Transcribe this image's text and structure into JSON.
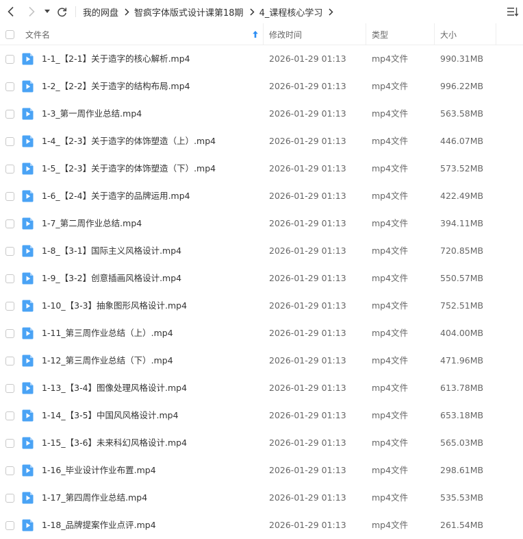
{
  "breadcrumb": [
    "我的网盘",
    "智疯字体版式设计课第18期",
    "4_课程核心学习"
  ],
  "columns": {
    "name": "文件名",
    "modified": "修改时间",
    "type": "类型",
    "size": "大小"
  },
  "sort": {
    "column": "name",
    "direction": "ascending"
  },
  "colors": {
    "accent": "#2b8df3",
    "file_icon": "#4aa3f5"
  },
  "files": [
    {
      "name": "1-1_【2-1】关于造字的核心解析.mp4",
      "modified": "2026-01-29 01:13",
      "type": "mp4文件",
      "size": "990.31MB"
    },
    {
      "name": "1-2_【2-2】关于造字的结构布局.mp4",
      "modified": "2026-01-29 01:13",
      "type": "mp4文件",
      "size": "996.22MB"
    },
    {
      "name": "1-3_第一周作业总结.mp4",
      "modified": "2026-01-29 01:13",
      "type": "mp4文件",
      "size": "563.58MB"
    },
    {
      "name": "1-4_【2-3】关于造字的体饰塑造（上）.mp4",
      "modified": "2026-01-29 01:13",
      "type": "mp4文件",
      "size": "446.07MB"
    },
    {
      "name": "1-5_【2-3】关于造字的体饰塑造（下）.mp4",
      "modified": "2026-01-29 01:13",
      "type": "mp4文件",
      "size": "573.52MB"
    },
    {
      "name": "1-6_【2-4】关于造字的品牌运用.mp4",
      "modified": "2026-01-29 01:13",
      "type": "mp4文件",
      "size": "422.49MB"
    },
    {
      "name": "1-7_第二周作业总结.mp4",
      "modified": "2026-01-29 01:13",
      "type": "mp4文件",
      "size": "394.11MB"
    },
    {
      "name": "1-8_【3-1】国际主义风格设计.mp4",
      "modified": "2026-01-29 01:13",
      "type": "mp4文件",
      "size": "720.85MB"
    },
    {
      "name": "1-9_【3-2】创意插画风格设计.mp4",
      "modified": "2026-01-29 01:13",
      "type": "mp4文件",
      "size": "550.57MB"
    },
    {
      "name": "1-10_【3-3】抽象图形风格设计.mp4",
      "modified": "2026-01-29 01:13",
      "type": "mp4文件",
      "size": "752.51MB"
    },
    {
      "name": "1-11_第三周作业总结（上）.mp4",
      "modified": "2026-01-29 01:13",
      "type": "mp4文件",
      "size": "404.00MB"
    },
    {
      "name": "1-12_第三周作业总结（下）.mp4",
      "modified": "2026-01-29 01:13",
      "type": "mp4文件",
      "size": "471.96MB"
    },
    {
      "name": "1-13_【3-4】图像处理风格设计.mp4",
      "modified": "2026-01-29 01:13",
      "type": "mp4文件",
      "size": "613.78MB"
    },
    {
      "name": "1-14_【3-5】中国风风格设计.mp4",
      "modified": "2026-01-29 01:13",
      "type": "mp4文件",
      "size": "653.18MB"
    },
    {
      "name": "1-15_【3-6】未来科幻风格设计.mp4",
      "modified": "2026-01-29 01:13",
      "type": "mp4文件",
      "size": "565.03MB"
    },
    {
      "name": "1-16_毕业设计作业布置.mp4",
      "modified": "2026-01-29 01:13",
      "type": "mp4文件",
      "size": "298.61MB"
    },
    {
      "name": "1-17_第四周作业总结.mp4",
      "modified": "2026-01-29 01:13",
      "type": "mp4文件",
      "size": "535.53MB"
    },
    {
      "name": "1-18_品牌提案作业点评.mp4",
      "modified": "2026-01-29 01:13",
      "type": "mp4文件",
      "size": "261.54MB"
    }
  ]
}
